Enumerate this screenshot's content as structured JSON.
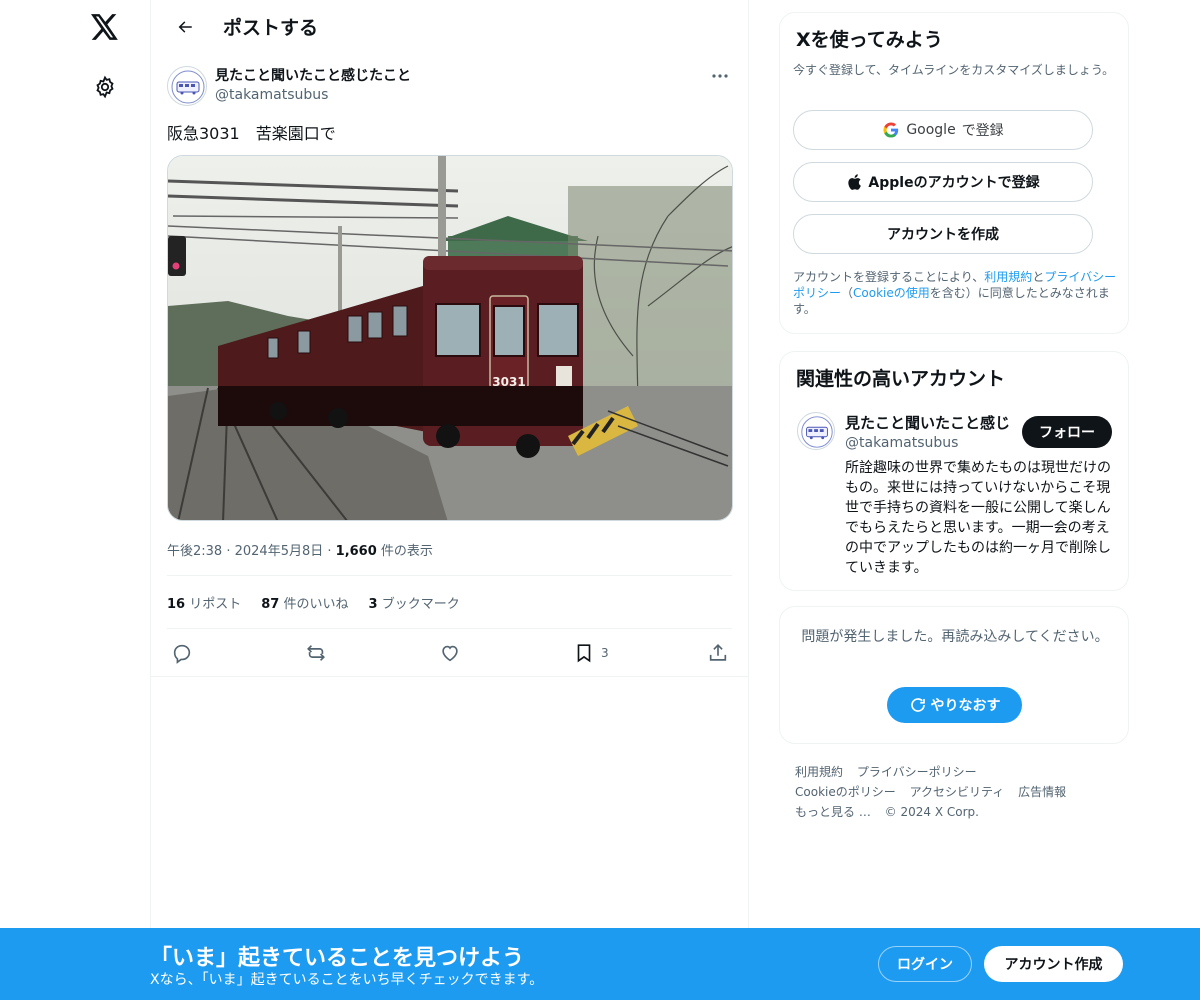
{
  "colors": {
    "accent": "#1d9bf0",
    "text_primary": "#0f1419",
    "text_secondary": "#536471",
    "border": "#eff3f4"
  },
  "nav": {
    "logo_icon": "x-logo-icon",
    "settings_icon": "gear-icon"
  },
  "header": {
    "title": "ポストする"
  },
  "post": {
    "author_name": "見たこと聞いたこと感じたこと",
    "author_handle": "@takamatsubus",
    "text": "阪急3031　苦楽園口で",
    "media_alt": "阪急3031",
    "train_number": "3031",
    "time": "午後2:38",
    "date": "2024年5月8日",
    "views_count": "1,660",
    "views_label": "件の表示",
    "reposts_count": "16",
    "reposts_label": "リポスト",
    "likes_count": "87",
    "likes_label": "件のいいね",
    "bookmarks_count": "3",
    "bookmarks_label": "ブックマーク",
    "bookmark_action_count": "3"
  },
  "signup": {
    "title": "Xを使ってみよう",
    "description": "今すぐ登録して、タイムラインをカスタマイズしましょう。",
    "google_brand": "Google",
    "google_suffix": "で登録",
    "apple_label": "Appleのアカウントで登録",
    "create_label": "アカウントを作成",
    "legal_1": "アカウントを登録することにより、",
    "legal_terms": "利用規約",
    "legal_2": "と",
    "legal_privacy": "プライバシーポリシー",
    "legal_3": "（",
    "legal_cookie": "Cookieの使用",
    "legal_4": "を含む）に同意したとみなされます。"
  },
  "related": {
    "title": "関連性の高いアカウント",
    "name": "見たこと聞いたこと感じ",
    "handle": "@takamatsubus",
    "follow_label": "フォロー",
    "bio": "所詮趣味の世界で集めたものは現世だけのもの。来世には持っていけないからこそ現世で手持ちの資料を一般に公開して楽しんでもらえたらと思います。一期一会の考えの中でアップしたものは約一ヶ月で削除していきます。"
  },
  "error": {
    "message": "問題が発生しました。再読み込みしてください。",
    "retry_label": "やりなおす"
  },
  "footer": {
    "links": [
      "利用規約",
      "プライバシーポリシー",
      "Cookieのポリシー",
      "アクセシビリティ",
      "広告情報",
      "もっと見る …",
      "© 2024 X Corp."
    ]
  },
  "banner": {
    "title": "「いま」起きていることを見つけよう",
    "subtitle": "Xなら、「いま」起きていることをいち早くチェックできます。",
    "login_label": "ログイン",
    "signup_label": "アカウント作成"
  }
}
